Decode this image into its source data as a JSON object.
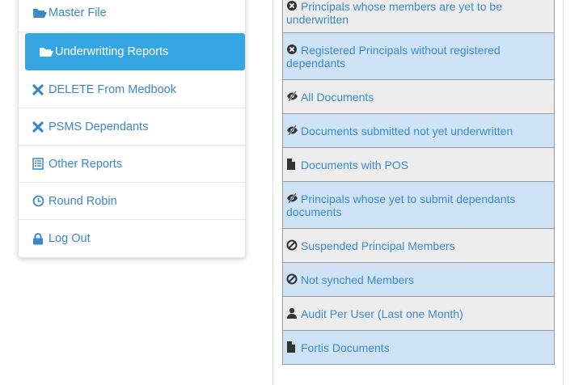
{
  "sidebar": {
    "items": [
      {
        "label": "Master File",
        "icon": "folder-open-icon"
      },
      {
        "label": "Underwritting Reports",
        "icon": "folder-open-icon",
        "active": true
      },
      {
        "label": "DELETE From Medbook",
        "icon": "close-icon"
      },
      {
        "label": "PSMS Dependants",
        "icon": "close-icon"
      },
      {
        "label": "Other Reports",
        "icon": "list-icon"
      },
      {
        "label": "Round Robin",
        "icon": "clock-icon"
      },
      {
        "label": "Log Out",
        "icon": "lock-icon"
      }
    ]
  },
  "reports": {
    "rows": [
      {
        "label": "Principals whose members are yet to be underwritten",
        "icon": "remove-circle-icon"
      },
      {
        "label": "Registered Principals without registered dependants",
        "icon": "remove-circle-icon"
      },
      {
        "label": "All Documents",
        "icon": "eye-slash-icon"
      },
      {
        "label": "Documents submitted not yet underwritten",
        "icon": "eye-slash-icon"
      },
      {
        "label": "Documents with POS",
        "icon": "file-icon"
      },
      {
        "label": "Principals whose yet to submit dependants documents",
        "icon": "eye-slash-icon"
      },
      {
        "label": "Suspended Principal Members",
        "icon": "ban-icon"
      },
      {
        "label": "Not synched Members",
        "icon": "ban-icon"
      },
      {
        "label": "Audit Per User (Last one Month)",
        "icon": "user-icon"
      },
      {
        "label": "Fortis Documents",
        "icon": "file-icon"
      }
    ]
  },
  "colors": {
    "accent": "#36a6e2",
    "link": "#3a8ccf",
    "row_grey": "#ededed",
    "row_blue": "#cfe3f6"
  }
}
